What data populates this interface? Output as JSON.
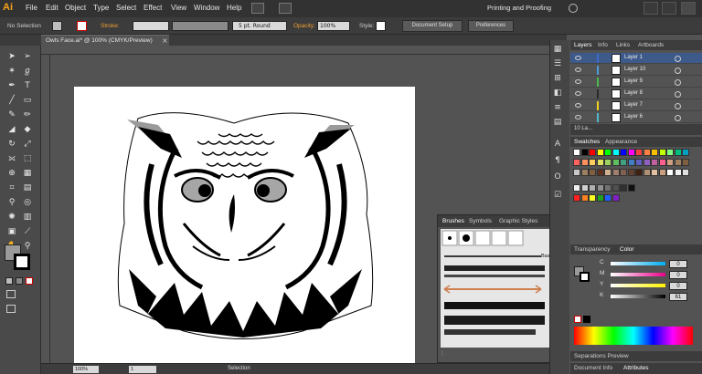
{
  "app": {
    "logo": "Ai",
    "menu": [
      "File",
      "Edit",
      "Object",
      "Type",
      "Select",
      "Effect",
      "View",
      "Window",
      "Help"
    ],
    "workspace": "Printing and Proofing",
    "search_icon": "search-icon"
  },
  "control_bar": {
    "selection_state": "No Selection",
    "stroke_label": "Stroke:",
    "brush_label": "5 pt. Round",
    "opacity_label": "Opacity:",
    "opacity_value": "100%",
    "style_label": "Style:",
    "document_setup": "Document Setup",
    "preferences": "Preferences"
  },
  "document": {
    "tab_title": "Owls Face.ai* @ 100% (CMYK/Preview)",
    "close_icon": "×"
  },
  "status_bar": {
    "zoom": "100%",
    "artboard": "1",
    "tool": "Selection"
  },
  "brushes_panel": {
    "tabs": [
      "Brushes",
      "Symbols",
      "Graphic Styles"
    ],
    "basic_label": "Basic"
  },
  "layers_panel": {
    "tabs": [
      "Layers",
      "Info",
      "Links",
      "Artboards"
    ],
    "layers": [
      {
        "name": "Layer 1",
        "color": "#3f6bc8",
        "selected": true
      },
      {
        "name": "Layer 10",
        "color": "#4f9ad8",
        "selected": false
      },
      {
        "name": "Layer 9",
        "color": "#4cb84c",
        "selected": false
      },
      {
        "name": "Layer 8",
        "color": "#2a2a2a",
        "selected": false
      },
      {
        "name": "Layer 7",
        "color": "#f0d020",
        "selected": false
      },
      {
        "name": "Layer 6",
        "color": "#4fb8c8",
        "selected": false
      }
    ],
    "footer": "10 La..."
  },
  "swatches_panel": {
    "tabs": [
      "Swatches",
      "Appearance"
    ],
    "colors_row1": [
      "#ffffff",
      "#000000",
      "#ff0000",
      "#ffff00",
      "#00ff00",
      "#00ffff",
      "#0000ff",
      "#ff00ff",
      "#ff4040",
      "#ff8040",
      "#ffc000",
      "#c0ff00",
      "#80ff80",
      "#00c080",
      "#00a0c0"
    ],
    "colors_row2": [
      "#ff6060",
      "#ff9060",
      "#ffcc60",
      "#e0e060",
      "#a0d060",
      "#60c060",
      "#40a080",
      "#4080c0",
      "#6060c0",
      "#9060c0",
      "#c060a0",
      "#ff6090",
      "#d0a080",
      "#a08060",
      "#806040"
    ],
    "colors_row3": [
      "#c8c8c8",
      "#9c8060",
      "#806040",
      "#603020",
      "#d0b090",
      "#a08070",
      "#806050",
      "#604030",
      "#402010",
      "#b09070",
      "#e0c0a0",
      "#c8a080",
      "#ffffff",
      "#f0f0f0",
      "#e0e0e0"
    ],
    "colors_row4": [
      "#f0f0f0",
      "#d0d0d0",
      "#b0b0b0",
      "#909090",
      "#707070",
      "#505050",
      "#303030",
      "#101010"
    ],
    "colors_row5": [
      "#ff2020",
      "#ff8020",
      "#ffff20",
      "#20a020",
      "#2060ff",
      "#8020c0"
    ]
  },
  "color_panel": {
    "tabs": [
      "Transparency",
      "Color"
    ],
    "sliders": [
      {
        "label": "C",
        "value": "0"
      },
      {
        "label": "M",
        "value": "0"
      },
      {
        "label": "Y",
        "value": "0"
      },
      {
        "label": "K",
        "value": "61"
      }
    ]
  },
  "bottom_panels": {
    "separations": "Separations Preview",
    "document_info": "Document Info",
    "attributes": "Attributes"
  }
}
